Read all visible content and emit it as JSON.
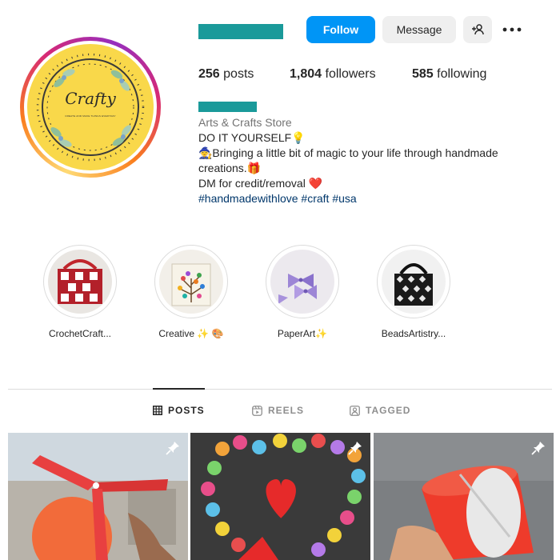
{
  "profile": {
    "avatar_brand": "Crafty",
    "avatar_tagline": "CREATE AND MAKE THINGS EVERYDAY",
    "buttons": {
      "follow": "Follow",
      "message": "Message",
      "add_user_icon": "add-user-icon",
      "more_icon": "more-dots-icon"
    },
    "stats": {
      "posts_count": "256",
      "posts_label": "posts",
      "followers_count": "1,804",
      "followers_label": "followers",
      "following_count": "585",
      "following_label": "following"
    },
    "bio": {
      "category": "Arts & Crafts Store",
      "line1": "DO IT YOURSELF💡",
      "line2": "🧙Bringing a little bit of magic to your life through handmade creations.🎁",
      "line3": "DM for credit/removal ❤️",
      "hashtags": "#handmadewithlove #craft #usa"
    },
    "colors": {
      "follow_blue": "#0095f6",
      "redacted_teal": "#1a9a9a",
      "hashtag_blue": "#00376b"
    }
  },
  "highlights": [
    {
      "label": "CrochetCraft..."
    },
    {
      "label": "Creative ✨ 🎨"
    },
    {
      "label": "PaperArt✨"
    },
    {
      "label": "BeadsArtistry..."
    }
  ],
  "tabs": [
    {
      "label": "POSTS",
      "icon": "grid-icon",
      "active": true
    },
    {
      "label": "REELS",
      "icon": "reels-icon",
      "active": false
    },
    {
      "label": "TAGGED",
      "icon": "tagged-icon",
      "active": false
    }
  ],
  "posts": [
    {
      "icon": "pin-icon"
    },
    {
      "icon": "pin-icon"
    },
    {
      "icon": "pin-icon"
    }
  ]
}
